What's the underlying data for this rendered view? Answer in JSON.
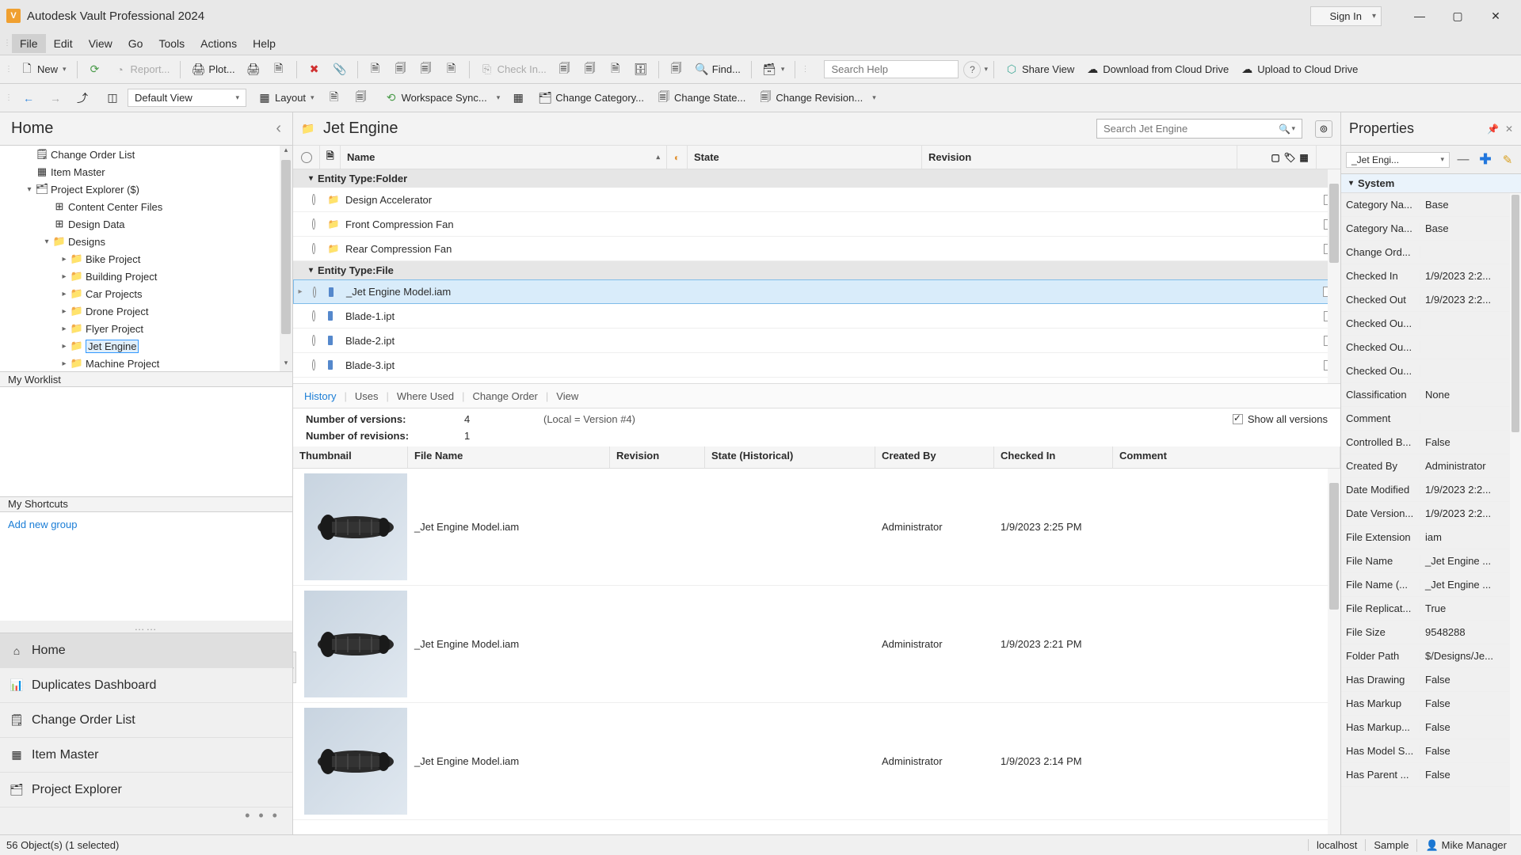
{
  "title": "Autodesk Vault Professional 2024",
  "signin": "Sign In",
  "menu": [
    "File",
    "Edit",
    "View",
    "Go",
    "Tools",
    "Actions",
    "Help"
  ],
  "toolbar1": {
    "new": "New",
    "report": "Report...",
    "plot": "Plot...",
    "checkin": "Check In...",
    "find": "Find...",
    "search_help_ph": "Search Help",
    "share_view": "Share View",
    "download": "Download from Cloud Drive",
    "upload": "Upload to Cloud Drive"
  },
  "toolbar2": {
    "view": "Default View",
    "layout": "Layout",
    "workspace": "Workspace Sync...",
    "change_cat": "Change Category...",
    "change_state": "Change State...",
    "change_rev": "Change Revision..."
  },
  "nav": {
    "home": "Home",
    "tree": [
      {
        "indent": 1,
        "exp": "",
        "ico": "doc",
        "label": "Change Order List"
      },
      {
        "indent": 1,
        "exp": "",
        "ico": "grid",
        "label": "Item Master"
      },
      {
        "indent": 1,
        "exp": "▾",
        "ico": "tree",
        "label": "Project Explorer ($)"
      },
      {
        "indent": 2,
        "exp": "",
        "ico": "grid3",
        "label": "Content Center Files"
      },
      {
        "indent": 2,
        "exp": "",
        "ico": "grid3",
        "label": "Design Data"
      },
      {
        "indent": 2,
        "exp": "▾",
        "ico": "folder",
        "label": "Designs"
      },
      {
        "indent": 3,
        "exp": "▸",
        "ico": "folder",
        "label": "Bike Project"
      },
      {
        "indent": 3,
        "exp": "▸",
        "ico": "folder",
        "label": "Building Project"
      },
      {
        "indent": 3,
        "exp": "▸",
        "ico": "folder",
        "label": "Car Projects"
      },
      {
        "indent": 3,
        "exp": "▸",
        "ico": "folder",
        "label": "Drone Project"
      },
      {
        "indent": 3,
        "exp": "▸",
        "ico": "folder",
        "label": "Flyer Project"
      },
      {
        "indent": 3,
        "exp": "▸",
        "ico": "folder",
        "label": "Jet Engine",
        "selected": true
      },
      {
        "indent": 3,
        "exp": "▸",
        "ico": "folder",
        "label": "Machine Project"
      }
    ],
    "worklist": "My Worklist",
    "shortcuts": "My Shortcuts",
    "addgroup": "Add new group",
    "bottom": [
      "Home",
      "Duplicates Dashboard",
      "Change Order List",
      "Item Master",
      "Project Explorer"
    ]
  },
  "center": {
    "folder": "Jet Engine",
    "search_ph": "Search Jet Engine",
    "cols": {
      "name": "Name",
      "state": "State",
      "revision": "Revision"
    },
    "group_folder": "Entity Type:Folder",
    "group_file": "Entity Type:File",
    "folders": [
      "Design Accelerator",
      "Front Compression Fan",
      "Rear Compression Fan"
    ],
    "files": [
      "_Jet Engine Model.iam",
      "Blade-1.ipt",
      "Blade-2.ipt",
      "Blade-3.ipt"
    ],
    "tabs": [
      "History",
      "Uses",
      "Where Used",
      "Change Order",
      "View"
    ],
    "num_versions_label": "Number of versions:",
    "num_versions": "4",
    "local_ver": "(Local = Version #4)",
    "num_rev_label": "Number of revisions:",
    "num_rev": "1",
    "show_all": "Show all versions",
    "hist_cols": {
      "thumb": "Thumbnail",
      "file": "File Name",
      "rev": "Revision",
      "state": "State (Historical)",
      "by": "Created By",
      "chk": "Checked In",
      "com": "Comment"
    },
    "history": [
      {
        "file": "_Jet Engine Model.iam",
        "by": "Administrator",
        "chk": "1/9/2023 2:25 PM"
      },
      {
        "file": "_Jet Engine Model.iam",
        "by": "Administrator",
        "chk": "1/9/2023 2:21 PM"
      },
      {
        "file": "_Jet Engine Model.iam",
        "by": "Administrator",
        "chk": "1/9/2023 2:14 PM"
      }
    ]
  },
  "props": {
    "title": "Properties",
    "sel": "_Jet Engi...",
    "group": "System",
    "rows": [
      {
        "k": "Category Na...",
        "v": "Base"
      },
      {
        "k": "Category Na...",
        "v": "Base"
      },
      {
        "k": "Change Ord...",
        "v": ""
      },
      {
        "k": "Checked In",
        "v": "1/9/2023 2:2..."
      },
      {
        "k": "Checked Out",
        "v": "1/9/2023 2:2..."
      },
      {
        "k": "Checked Ou...",
        "v": ""
      },
      {
        "k": "Checked Ou...",
        "v": ""
      },
      {
        "k": "Checked Ou...",
        "v": ""
      },
      {
        "k": "Classification",
        "v": "None"
      },
      {
        "k": "Comment",
        "v": ""
      },
      {
        "k": "Controlled B...",
        "v": "False"
      },
      {
        "k": "Created By",
        "v": "Administrator"
      },
      {
        "k": "Date Modified",
        "v": "1/9/2023 2:2..."
      },
      {
        "k": "Date Version...",
        "v": "1/9/2023 2:2..."
      },
      {
        "k": "File Extension",
        "v": "iam"
      },
      {
        "k": "File Name",
        "v": "_Jet Engine ..."
      },
      {
        "k": "File Name (...",
        "v": "_Jet Engine ..."
      },
      {
        "k": "File Replicat...",
        "v": "True"
      },
      {
        "k": "File Size",
        "v": "9548288"
      },
      {
        "k": "Folder Path",
        "v": "$/Designs/Je..."
      },
      {
        "k": "Has Drawing",
        "v": "False"
      },
      {
        "k": "Has Markup",
        "v": "False"
      },
      {
        "k": "Has Markup...",
        "v": "False"
      },
      {
        "k": "Has Model S...",
        "v": "False"
      },
      {
        "k": "Has Parent ...",
        "v": "False"
      }
    ]
  },
  "status": {
    "left": "56 Object(s) (1 selected)",
    "host": "localhost",
    "db": "Sample",
    "user": "Mike Manager"
  }
}
